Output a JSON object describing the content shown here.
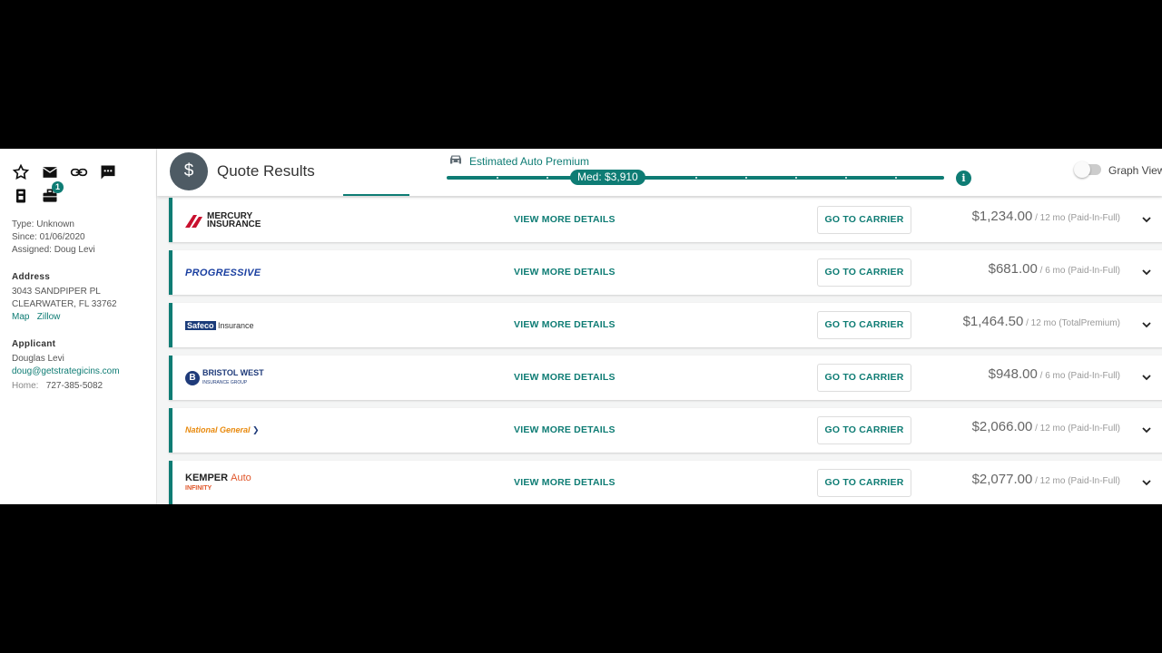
{
  "sidebar": {
    "icons": [
      "star-icon",
      "email-icon",
      "link-icon",
      "message-icon"
    ],
    "icons_row2": [
      "phone-doc-icon",
      "briefcase-icon"
    ],
    "briefcase_badge": "1",
    "type": "Type: Unknown",
    "since": "Since: 01/06/2020",
    "assigned": "Assigned: Doug Levi",
    "address": {
      "title": "Address",
      "line1": "3043 SANDPIPER PL",
      "line2": "CLEARWATER, FL 33762",
      "map": "Map",
      "zillow": "Zillow"
    },
    "applicant": {
      "title": "Applicant",
      "name": "Douglas Levi",
      "email": "doug@getstrategicins.com",
      "phone_label": "Home:",
      "phone": "727-385-5082"
    }
  },
  "header": {
    "icon": "$",
    "title": "Quote Results",
    "estimate_label": "Estimated Auto Premium",
    "median": "Med: $3,910",
    "info": "i",
    "graph_view": "Graph View"
  },
  "quotes": [
    {
      "carrier": "MERCURY INSURANCE",
      "logo_text": [
        "MERCURY",
        "INSURANCE"
      ],
      "details": "VIEW MORE DETAILS",
      "go": "GO TO CARRIER",
      "price": "$1,234.00",
      "term": " / 12 mo (Paid-In-Full)"
    },
    {
      "carrier": "PROGRESSIVE",
      "logo_text": [
        "PROGRESSIVE"
      ],
      "details": "VIEW MORE DETAILS",
      "go": "GO TO CARRIER",
      "price": "$681.00",
      "term": " / 6 mo (Paid-In-Full)"
    },
    {
      "carrier": "Safeco Insurance",
      "logo_text": [
        "Safeco",
        "Insurance"
      ],
      "details": "VIEW MORE DETAILS",
      "go": "GO TO CARRIER",
      "price": "$1,464.50",
      "term": " / 12 mo (TotalPremium)"
    },
    {
      "carrier": "BRISTOL WEST",
      "logo_text": [
        "BRISTOL WEST",
        "INSURANCE GROUP"
      ],
      "details": "VIEW MORE DETAILS",
      "go": "GO TO CARRIER",
      "price": "$948.00",
      "term": " / 6 mo (Paid-In-Full)"
    },
    {
      "carrier": "National General",
      "logo_text": [
        "National General"
      ],
      "details": "VIEW MORE DETAILS",
      "go": "GO TO CARRIER",
      "price": "$2,066.00",
      "term": " / 12 mo (Paid-In-Full)"
    },
    {
      "carrier": "KEMPER Auto",
      "logo_text": [
        "KEMPER",
        "Auto",
        "INFINITY"
      ],
      "details": "VIEW MORE DETAILS",
      "go": "GO TO CARRIER",
      "price": "$2,077.00",
      "term": " / 12 mo (Paid-In-Full)"
    }
  ],
  "colors": {
    "accent": "#0e7c74",
    "header_icon_bg": "#4e5b64"
  }
}
